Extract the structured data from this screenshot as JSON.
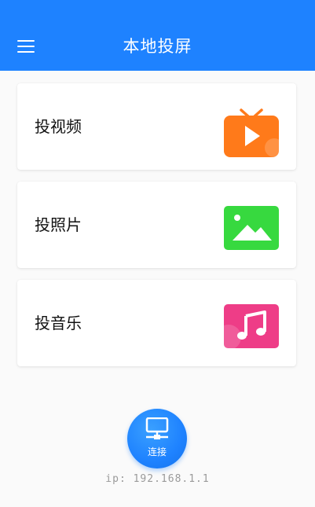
{
  "header": {
    "title": "本地投屏",
    "menu_icon": "menu-icon",
    "color": "#1e82ff"
  },
  "cards": [
    {
      "label": "投视频",
      "icon": "tv-play-icon",
      "icon_color": "#ff7a1a"
    },
    {
      "label": "投照片",
      "icon": "image-icon",
      "icon_color": "#37d93f"
    },
    {
      "label": "投音乐",
      "icon": "music-note-icon",
      "icon_color": "#ee3d87"
    }
  ],
  "connect": {
    "label": "连接",
    "icon": "monitor-network-icon"
  },
  "ip": {
    "text": "ip: 192.168.1.1"
  }
}
